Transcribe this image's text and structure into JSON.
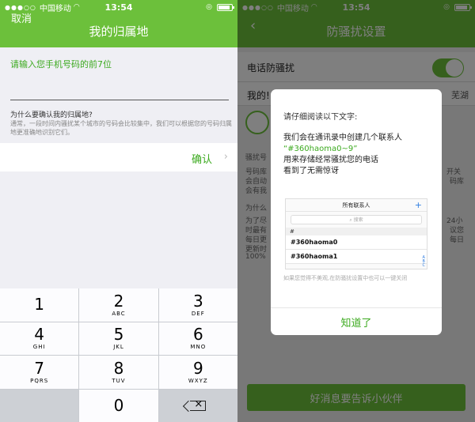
{
  "status": {
    "carrier": "中国移动",
    "time": "13:54"
  },
  "left": {
    "cancel": "取消",
    "title": "我的归属地",
    "prompt": "请输入您手机号码的前7位",
    "why_title": "为什么要确认我的归属地?",
    "why_text": "通常，一段时间内骚扰某个城市的号码会比较集中，我们可以根据您的号码归属地更准确地识别它们。",
    "confirm": "确认",
    "keys": [
      {
        "num": "1",
        "letters": ""
      },
      {
        "num": "2",
        "letters": "ABC"
      },
      {
        "num": "3",
        "letters": "DEF"
      },
      {
        "num": "4",
        "letters": "GHI"
      },
      {
        "num": "5",
        "letters": "JKL"
      },
      {
        "num": "6",
        "letters": "MNO"
      },
      {
        "num": "7",
        "letters": "PQRS"
      },
      {
        "num": "8",
        "letters": "TUV"
      },
      {
        "num": "9",
        "letters": "WXYZ"
      },
      {
        "num": "0",
        "letters": ""
      }
    ]
  },
  "right": {
    "title": "防骚扰设置",
    "row1": "电话防骚扰",
    "row2_left": "我的!",
    "row2_right": "芜湖",
    "bg_texts": [
      "骚扰号",
      "号码库",
      "会自动",
      "会有我",
      "为什么",
      "为了尽",
      "时最有",
      "每日更",
      "更新时",
      "开关",
      "码库",
      "24小",
      "议您",
      "每日",
      "100%"
    ],
    "bottom_btn": "好消息要告诉小伙伴",
    "modal": {
      "title": "请仔细阅读以下文字:",
      "line1": "我们会在通讯录中创建几个联系人",
      "highlight": "“#360haoma0~9”",
      "line2": "用来存储经常骚扰您的电话",
      "line3": "看到了无需惊讶",
      "shot_title": "所有联系人",
      "shot_search": "搜索",
      "shot_section": "#",
      "shot_items": [
        "#360haoma0",
        "#360haoma1"
      ],
      "note": "如果您觉得不美观,在防骚扰设置中也可以一键关闭",
      "button": "知道了"
    }
  }
}
